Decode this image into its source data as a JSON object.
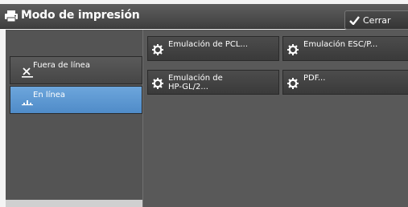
{
  "header": {
    "title": "Modo de impresión",
    "close_label": "Cerrar"
  },
  "modes": [
    {
      "label": "Fuera de línea",
      "selected": false
    },
    {
      "label": "En línea",
      "selected": true
    }
  ],
  "emulations": [
    {
      "label": "Emulación de PCL..."
    },
    {
      "label": "Emulación ESC/P..."
    },
    {
      "label_line1": "Emulación de",
      "label_line2": "HP-GL/2..."
    },
    {
      "label": "PDF..."
    }
  ],
  "colors": {
    "selected": "#5a97d2",
    "titlebar": "#4a4a4a",
    "panel": "#595959"
  }
}
